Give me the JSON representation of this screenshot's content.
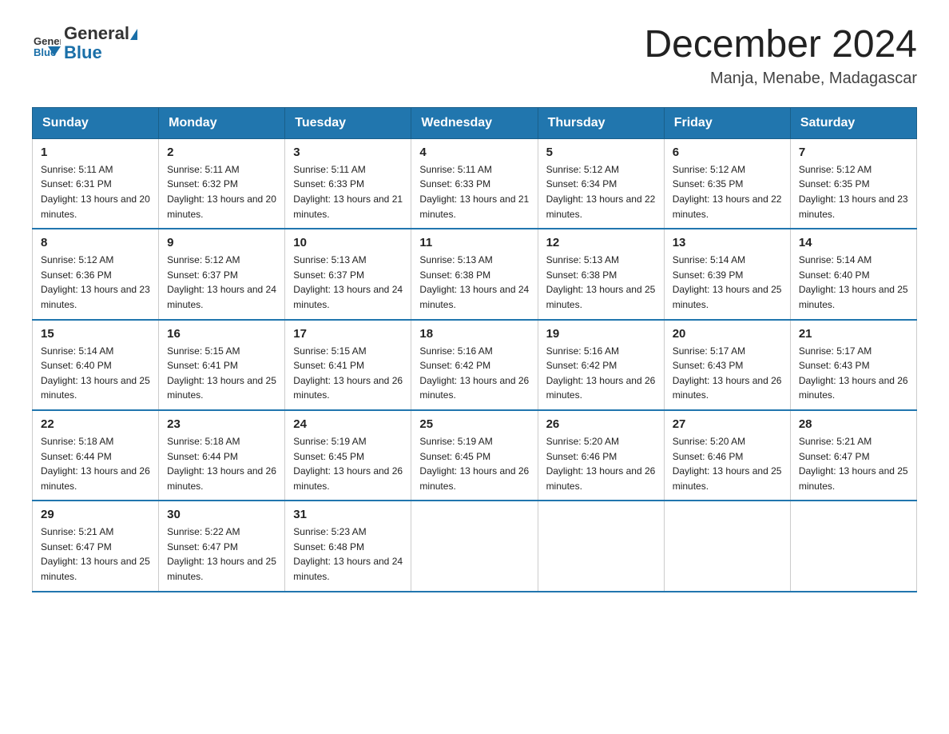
{
  "header": {
    "logo_general": "General",
    "logo_blue": "Blue",
    "month_title": "December 2024",
    "location": "Manja, Menabe, Madagascar"
  },
  "weekdays": [
    "Sunday",
    "Monday",
    "Tuesday",
    "Wednesday",
    "Thursday",
    "Friday",
    "Saturday"
  ],
  "weeks": [
    [
      {
        "day": "1",
        "sunrise": "5:11 AM",
        "sunset": "6:31 PM",
        "daylight": "13 hours and 20 minutes."
      },
      {
        "day": "2",
        "sunrise": "5:11 AM",
        "sunset": "6:32 PM",
        "daylight": "13 hours and 20 minutes."
      },
      {
        "day": "3",
        "sunrise": "5:11 AM",
        "sunset": "6:33 PM",
        "daylight": "13 hours and 21 minutes."
      },
      {
        "day": "4",
        "sunrise": "5:11 AM",
        "sunset": "6:33 PM",
        "daylight": "13 hours and 21 minutes."
      },
      {
        "day": "5",
        "sunrise": "5:12 AM",
        "sunset": "6:34 PM",
        "daylight": "13 hours and 22 minutes."
      },
      {
        "day": "6",
        "sunrise": "5:12 AM",
        "sunset": "6:35 PM",
        "daylight": "13 hours and 22 minutes."
      },
      {
        "day": "7",
        "sunrise": "5:12 AM",
        "sunset": "6:35 PM",
        "daylight": "13 hours and 23 minutes."
      }
    ],
    [
      {
        "day": "8",
        "sunrise": "5:12 AM",
        "sunset": "6:36 PM",
        "daylight": "13 hours and 23 minutes."
      },
      {
        "day": "9",
        "sunrise": "5:12 AM",
        "sunset": "6:37 PM",
        "daylight": "13 hours and 24 minutes."
      },
      {
        "day": "10",
        "sunrise": "5:13 AM",
        "sunset": "6:37 PM",
        "daylight": "13 hours and 24 minutes."
      },
      {
        "day": "11",
        "sunrise": "5:13 AM",
        "sunset": "6:38 PM",
        "daylight": "13 hours and 24 minutes."
      },
      {
        "day": "12",
        "sunrise": "5:13 AM",
        "sunset": "6:38 PM",
        "daylight": "13 hours and 25 minutes."
      },
      {
        "day": "13",
        "sunrise": "5:14 AM",
        "sunset": "6:39 PM",
        "daylight": "13 hours and 25 minutes."
      },
      {
        "day": "14",
        "sunrise": "5:14 AM",
        "sunset": "6:40 PM",
        "daylight": "13 hours and 25 minutes."
      }
    ],
    [
      {
        "day": "15",
        "sunrise": "5:14 AM",
        "sunset": "6:40 PM",
        "daylight": "13 hours and 25 minutes."
      },
      {
        "day": "16",
        "sunrise": "5:15 AM",
        "sunset": "6:41 PM",
        "daylight": "13 hours and 25 minutes."
      },
      {
        "day": "17",
        "sunrise": "5:15 AM",
        "sunset": "6:41 PM",
        "daylight": "13 hours and 26 minutes."
      },
      {
        "day": "18",
        "sunrise": "5:16 AM",
        "sunset": "6:42 PM",
        "daylight": "13 hours and 26 minutes."
      },
      {
        "day": "19",
        "sunrise": "5:16 AM",
        "sunset": "6:42 PM",
        "daylight": "13 hours and 26 minutes."
      },
      {
        "day": "20",
        "sunrise": "5:17 AM",
        "sunset": "6:43 PM",
        "daylight": "13 hours and 26 minutes."
      },
      {
        "day": "21",
        "sunrise": "5:17 AM",
        "sunset": "6:43 PM",
        "daylight": "13 hours and 26 minutes."
      }
    ],
    [
      {
        "day": "22",
        "sunrise": "5:18 AM",
        "sunset": "6:44 PM",
        "daylight": "13 hours and 26 minutes."
      },
      {
        "day": "23",
        "sunrise": "5:18 AM",
        "sunset": "6:44 PM",
        "daylight": "13 hours and 26 minutes."
      },
      {
        "day": "24",
        "sunrise": "5:19 AM",
        "sunset": "6:45 PM",
        "daylight": "13 hours and 26 minutes."
      },
      {
        "day": "25",
        "sunrise": "5:19 AM",
        "sunset": "6:45 PM",
        "daylight": "13 hours and 26 minutes."
      },
      {
        "day": "26",
        "sunrise": "5:20 AM",
        "sunset": "6:46 PM",
        "daylight": "13 hours and 26 minutes."
      },
      {
        "day": "27",
        "sunrise": "5:20 AM",
        "sunset": "6:46 PM",
        "daylight": "13 hours and 25 minutes."
      },
      {
        "day": "28",
        "sunrise": "5:21 AM",
        "sunset": "6:47 PM",
        "daylight": "13 hours and 25 minutes."
      }
    ],
    [
      {
        "day": "29",
        "sunrise": "5:21 AM",
        "sunset": "6:47 PM",
        "daylight": "13 hours and 25 minutes."
      },
      {
        "day": "30",
        "sunrise": "5:22 AM",
        "sunset": "6:47 PM",
        "daylight": "13 hours and 25 minutes."
      },
      {
        "day": "31",
        "sunrise": "5:23 AM",
        "sunset": "6:48 PM",
        "daylight": "13 hours and 24 minutes."
      },
      null,
      null,
      null,
      null
    ]
  ]
}
